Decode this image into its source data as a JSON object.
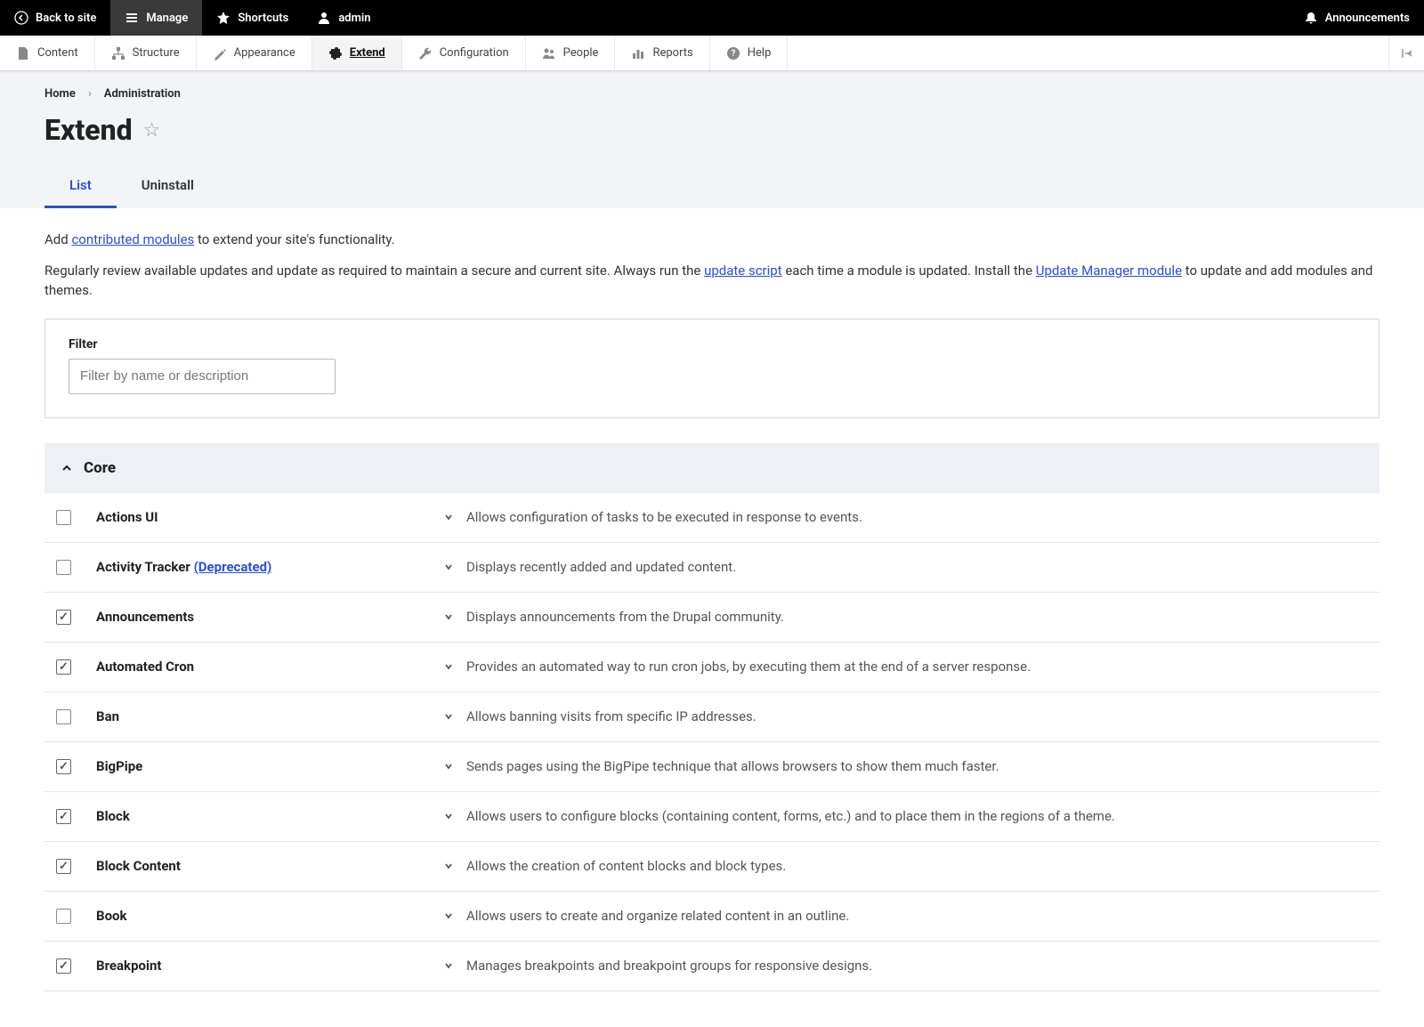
{
  "topbar": {
    "back": "Back to site",
    "manage": "Manage",
    "shortcuts": "Shortcuts",
    "user": "admin",
    "announcements": "Announcements"
  },
  "secbar": {
    "content": "Content",
    "structure": "Structure",
    "appearance": "Appearance",
    "extend": "Extend",
    "configuration": "Configuration",
    "people": "People",
    "reports": "Reports",
    "help": "Help"
  },
  "breadcrumb": {
    "home": "Home",
    "admin": "Administration"
  },
  "page": {
    "title": "Extend"
  },
  "tabs": {
    "list": "List",
    "uninstall": "Uninstall"
  },
  "intro": {
    "line1_a": "Add ",
    "line1_link": "contributed modules",
    "line1_b": " to extend your site's functionality.",
    "line2_a": "Regularly review available updates and update as required to maintain a secure and current site. Always run the ",
    "line2_link1": "update script",
    "line2_b": " each time a module is updated. Install the ",
    "line2_link2": "Update Manager module",
    "line2_c": " to update and add modules and themes."
  },
  "filter": {
    "label": "Filter",
    "placeholder": "Filter by name or description"
  },
  "section": {
    "title": "Core"
  },
  "modules": [
    {
      "name": "Actions UI",
      "deprecated": false,
      "checked": false,
      "desc": "Allows configuration of tasks to be executed in response to events."
    },
    {
      "name": "Activity Tracker",
      "deprecated": true,
      "deprecated_label": "(Deprecated)",
      "checked": false,
      "desc": "Displays recently added and updated content."
    },
    {
      "name": "Announcements",
      "deprecated": false,
      "checked": true,
      "desc": "Displays announcements from the Drupal community."
    },
    {
      "name": "Automated Cron",
      "deprecated": false,
      "checked": true,
      "desc": "Provides an automated way to run cron jobs, by executing them at the end of a server response."
    },
    {
      "name": "Ban",
      "deprecated": false,
      "checked": false,
      "desc": "Allows banning visits from specific IP addresses."
    },
    {
      "name": "BigPipe",
      "deprecated": false,
      "checked": true,
      "desc": "Sends pages using the BigPipe technique that allows browsers to show them much faster."
    },
    {
      "name": "Block",
      "deprecated": false,
      "checked": true,
      "desc": "Allows users to configure blocks (containing content, forms, etc.) and to place them in the regions of a theme."
    },
    {
      "name": "Block Content",
      "deprecated": false,
      "checked": true,
      "desc": "Allows the creation of content blocks and block types."
    },
    {
      "name": "Book",
      "deprecated": false,
      "checked": false,
      "desc": "Allows users to create and organize related content in an outline."
    },
    {
      "name": "Breakpoint",
      "deprecated": false,
      "checked": true,
      "desc": "Manages breakpoints and breakpoint groups for responsive designs."
    }
  ]
}
